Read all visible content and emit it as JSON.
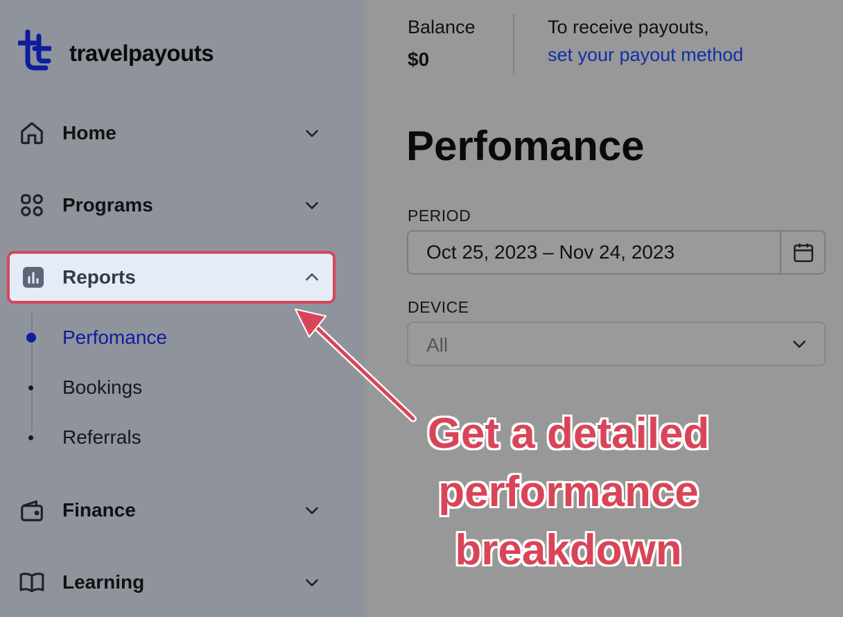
{
  "brand": {
    "name": "travelpayouts"
  },
  "nav": {
    "items": [
      {
        "label": "Home",
        "icon": "home-icon"
      },
      {
        "label": "Programs",
        "icon": "grid-icon"
      },
      {
        "label": "Reports",
        "icon": "bar-chart-icon",
        "expanded": true
      },
      {
        "label": "Finance",
        "icon": "wallet-icon"
      },
      {
        "label": "Learning",
        "icon": "book-icon"
      }
    ],
    "reports_sub": [
      {
        "label": "Perfomance",
        "active": true
      },
      {
        "label": "Bookings"
      },
      {
        "label": "Referrals"
      }
    ]
  },
  "header": {
    "balance_label": "Balance",
    "balance_value": "$0",
    "payout_text": "To receive payouts,",
    "payout_link": "set your payout method"
  },
  "main": {
    "title": "Perfomance",
    "period_label": "PERIOD",
    "period_value": "Oct 25, 2023 – Nov 24, 2023",
    "device_label": "DEVICE",
    "device_value": "All"
  },
  "annotation": {
    "lines": [
      "Get a detailed",
      "performance",
      "breakdown"
    ]
  },
  "colors": {
    "sidebar_bg": "#8f939c",
    "main_bg": "#989898",
    "highlight": "#d94558",
    "active_bg": "#e3ecf7",
    "brand_blue": "#0d1d9e",
    "link": "#0f2fa8"
  }
}
